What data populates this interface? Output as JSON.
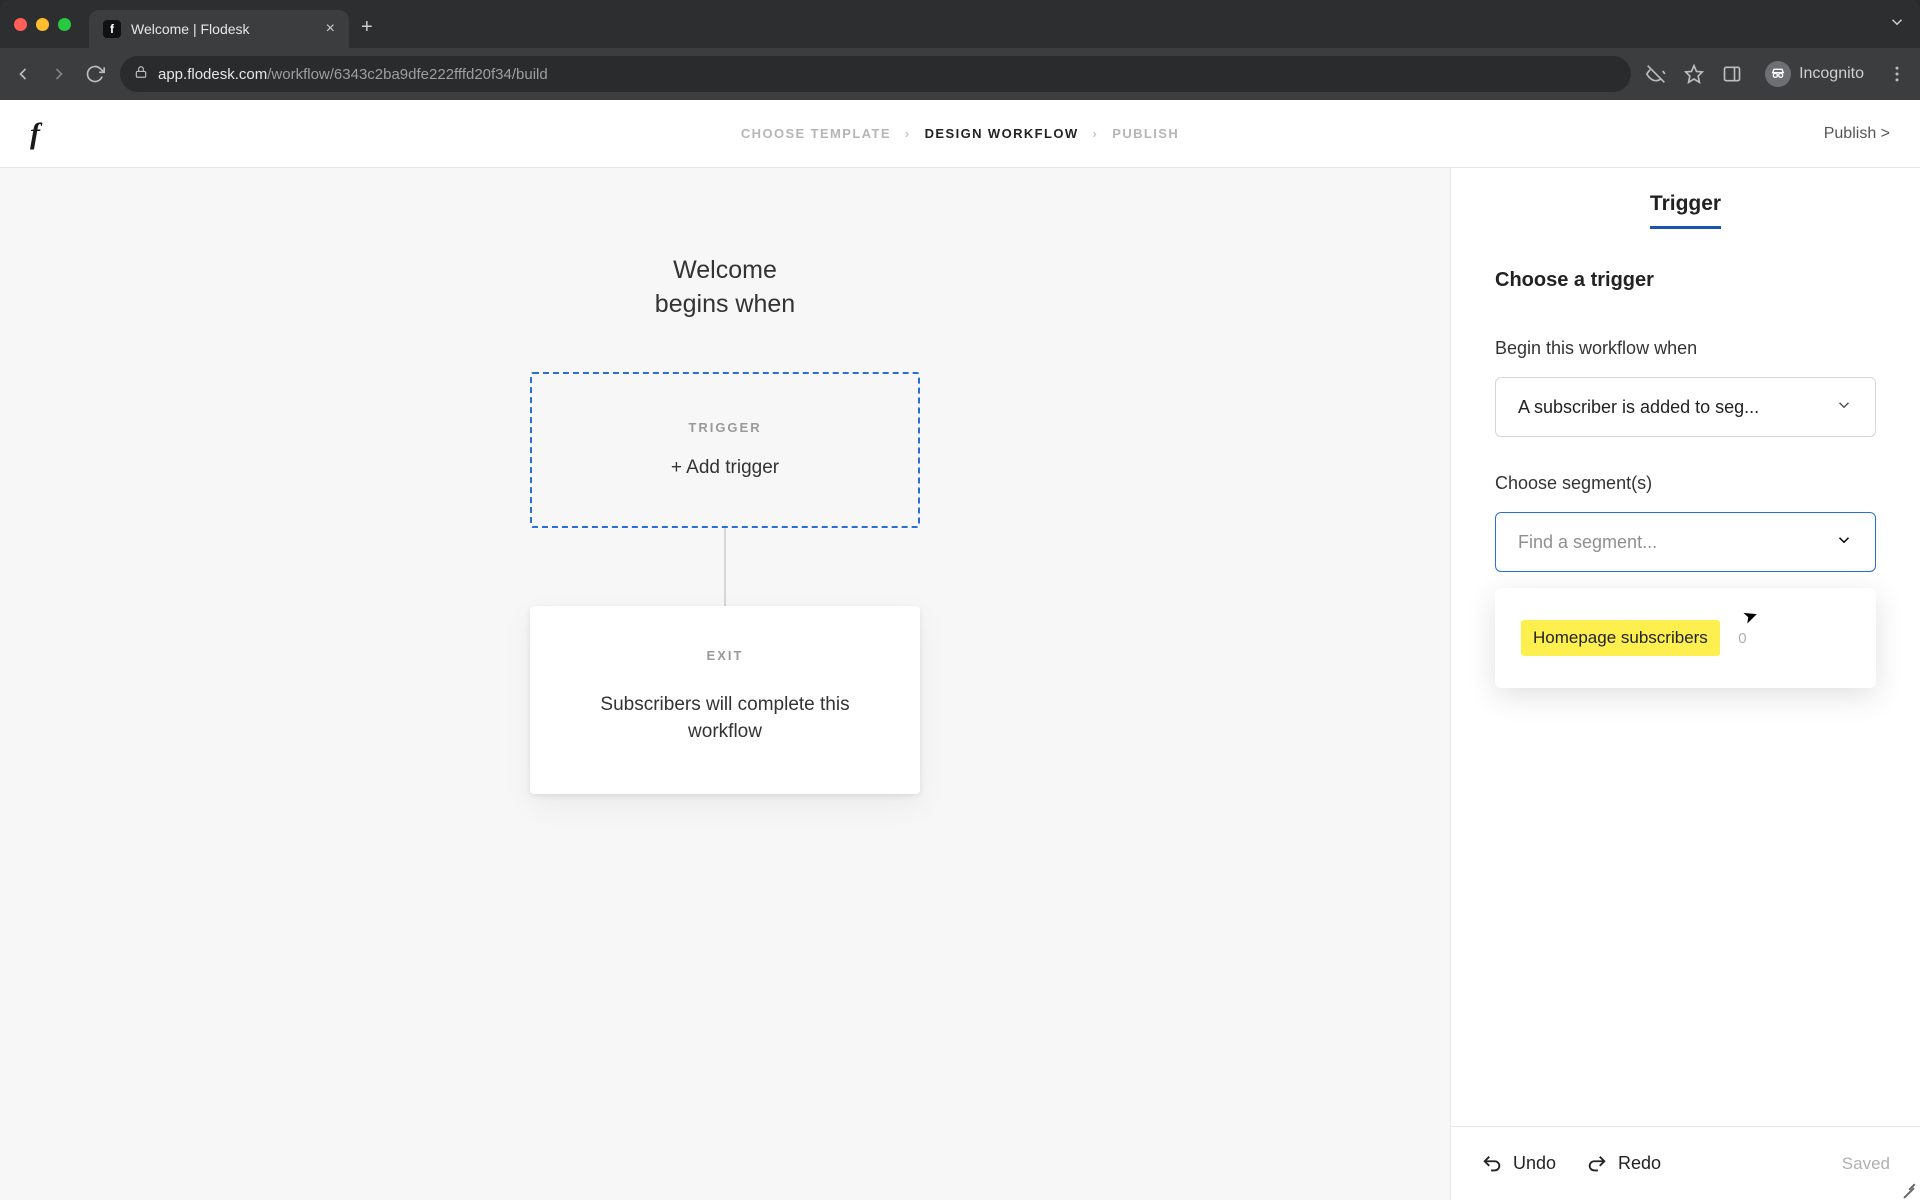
{
  "browser": {
    "tab_title": "Welcome | Flodesk",
    "url_host": "app.flodesk.com",
    "url_path": "/workflow/6343c2ba9dfe222fffd20f34/build",
    "incognito_label": "Incognito"
  },
  "header": {
    "breadcrumb": {
      "step1": "CHOOSE TEMPLATE",
      "step2": "DESIGN WORKFLOW",
      "step3": "PUBLISH"
    },
    "publish_link": "Publish >"
  },
  "canvas": {
    "title_line1": "Welcome",
    "title_line2": "begins when",
    "trigger": {
      "label": "TRIGGER",
      "add_text": "+ Add trigger"
    },
    "exit": {
      "label": "EXIT",
      "description": "Subscribers will complete this workflow"
    }
  },
  "panel": {
    "tab_label": "Trigger",
    "heading": "Choose a trigger",
    "begin_label": "Begin this workflow when",
    "trigger_select_value": "A subscriber is added to seg...",
    "segments_label": "Choose segment(s)",
    "segment_placeholder": "Find a segment...",
    "dropdown_option": {
      "name": "Homepage subscribers",
      "count": "0"
    },
    "footer": {
      "undo": "Undo",
      "redo": "Redo",
      "saved": "Saved"
    }
  }
}
